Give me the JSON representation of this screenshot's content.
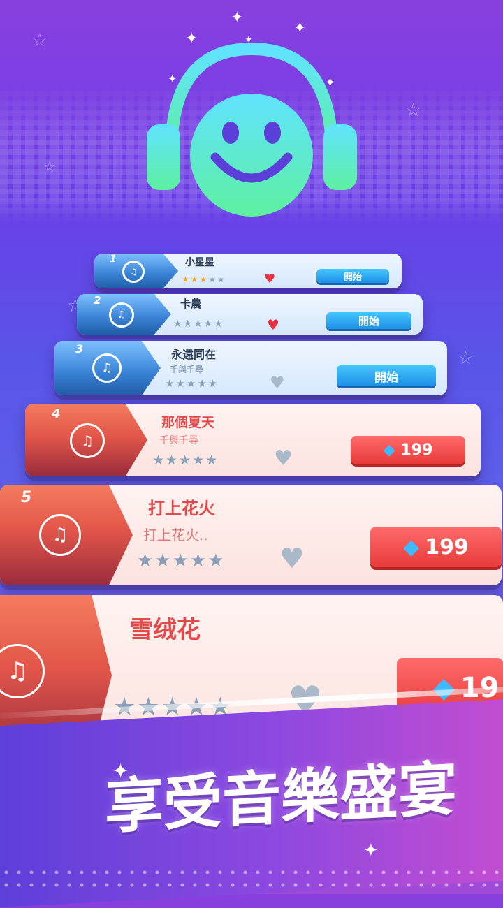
{
  "slogan": "享受音樂盛宴",
  "colors": {
    "logo": "#5ee7a4",
    "accent_blue": "#2b9cf0",
    "accent_red": "#e8423f",
    "star_rating": "#f4a51c",
    "heart_active": "#e8323f"
  },
  "songs": [
    {
      "number": "1",
      "title": "小星星",
      "artist": "",
      "rating": 3,
      "max_rating": 5,
      "favorited": true,
      "action": "開始",
      "action_type": "start",
      "theme": "blue"
    },
    {
      "number": "2",
      "title": "卡農",
      "artist": "",
      "rating": 0,
      "max_rating": 5,
      "favorited": true,
      "action": "開始",
      "action_type": "start",
      "theme": "blue"
    },
    {
      "number": "3",
      "title": "永遠同在",
      "artist": "千與千尋",
      "rating": 0,
      "max_rating": 5,
      "favorited": false,
      "action": "開始",
      "action_type": "start",
      "theme": "blue"
    },
    {
      "number": "4",
      "title": "那個夏天",
      "artist": "千與千尋",
      "rating": 0,
      "max_rating": 5,
      "favorited": false,
      "action": "199",
      "action_type": "price",
      "theme": "red"
    },
    {
      "number": "5",
      "title": "打上花火",
      "artist": "打上花火..",
      "rating": 0,
      "max_rating": 5,
      "favorited": false,
      "action": "199",
      "action_type": "price",
      "theme": "red"
    },
    {
      "number": "",
      "title": "雪绒花",
      "artist": "",
      "rating": 0,
      "max_rating": 5,
      "favorited": false,
      "action": "19",
      "action_type": "price",
      "theme": "red"
    }
  ],
  "icons": {
    "logo": "smiley-headphones-icon",
    "song_thumb": "music-headphones-icon",
    "price": "diamond-icon",
    "favorite": "heart-icon",
    "rating": "star-icon"
  }
}
